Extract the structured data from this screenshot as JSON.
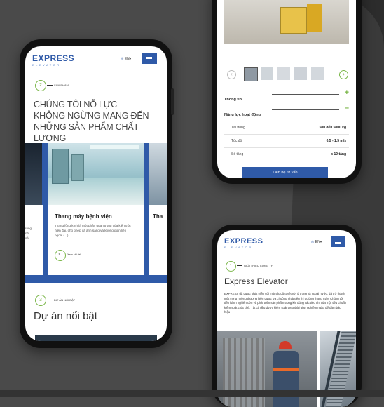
{
  "colors": {
    "brand_blue": "#2f5aa8",
    "accent_green": "#7ab648",
    "background": "#4a4a4a",
    "dark_band": "#3a3a3a"
  },
  "phone_left": {
    "logo": "EXPRESS",
    "logo_sub": "ELEVATOR",
    "lang": "EN",
    "section_num": "2",
    "section_tag": "SẢN PHẨM",
    "headline": [
      "CHÚNG TÔI NỖ LỰC",
      "KHÔNG NGỪNG MANG ĐẾN",
      "NHỮNG SẢN PHẨM CHẤT LƯỢNG"
    ],
    "card_title": "Thang máy bệnh viện",
    "card_desc": "Thang lồng kính là một phần quan trọng của kiến trúc hiện đại, cho phép cả ánh sáng và không gian liền ngoài (...)",
    "card_link": "Xem chi tiết",
    "left_partial_text": "rong\nnh\nsát",
    "right_partial_title": "Tha",
    "section3_num": "3",
    "section3_tag": "DỰ ÁN NỔI BẬT",
    "section3_title": "Dự án nổi bật"
  },
  "phone_top": {
    "rows": [
      {
        "label": "Thông tin",
        "icon": "plus-icon"
      },
      {
        "label": "Năng lực hoạt động",
        "icon": "minus-icon"
      }
    ],
    "specs": [
      {
        "k": "Tải trọng",
        "v": "500 đến 5000 kg"
      },
      {
        "k": "Tốc độ",
        "v": "0.5 - 1.5 m/s"
      },
      {
        "k": "Số tầng",
        "v": "≤ 10 tầng"
      }
    ],
    "cta": "Liên hệ tư vấn"
  },
  "phone_bottom": {
    "logo": "EXPRESS",
    "logo_sub": "ELEVATOR",
    "lang": "EN",
    "section_num": "1",
    "section_tag": "GIỚI THIỆU CÔNG TY",
    "title": "Express Elevator",
    "body": "EXPRESS đã được phát triển với một tốc độ tuyệt vời ở trong và ngoài nước, đã trở thành một trong những thương hiệu được ưa chuộng nhất trên thị trường thang máy. Chúng tôi tiến hành nghiên cứu và phát triển sản phẩm trong khi đúng các tiêu chí của một tiêu chuẩn kiểm soát chặt chẽ. Tất cả đều được kiểm soát theo thời gian nghiêm ngặt, để đảm bảo hiệu"
  }
}
